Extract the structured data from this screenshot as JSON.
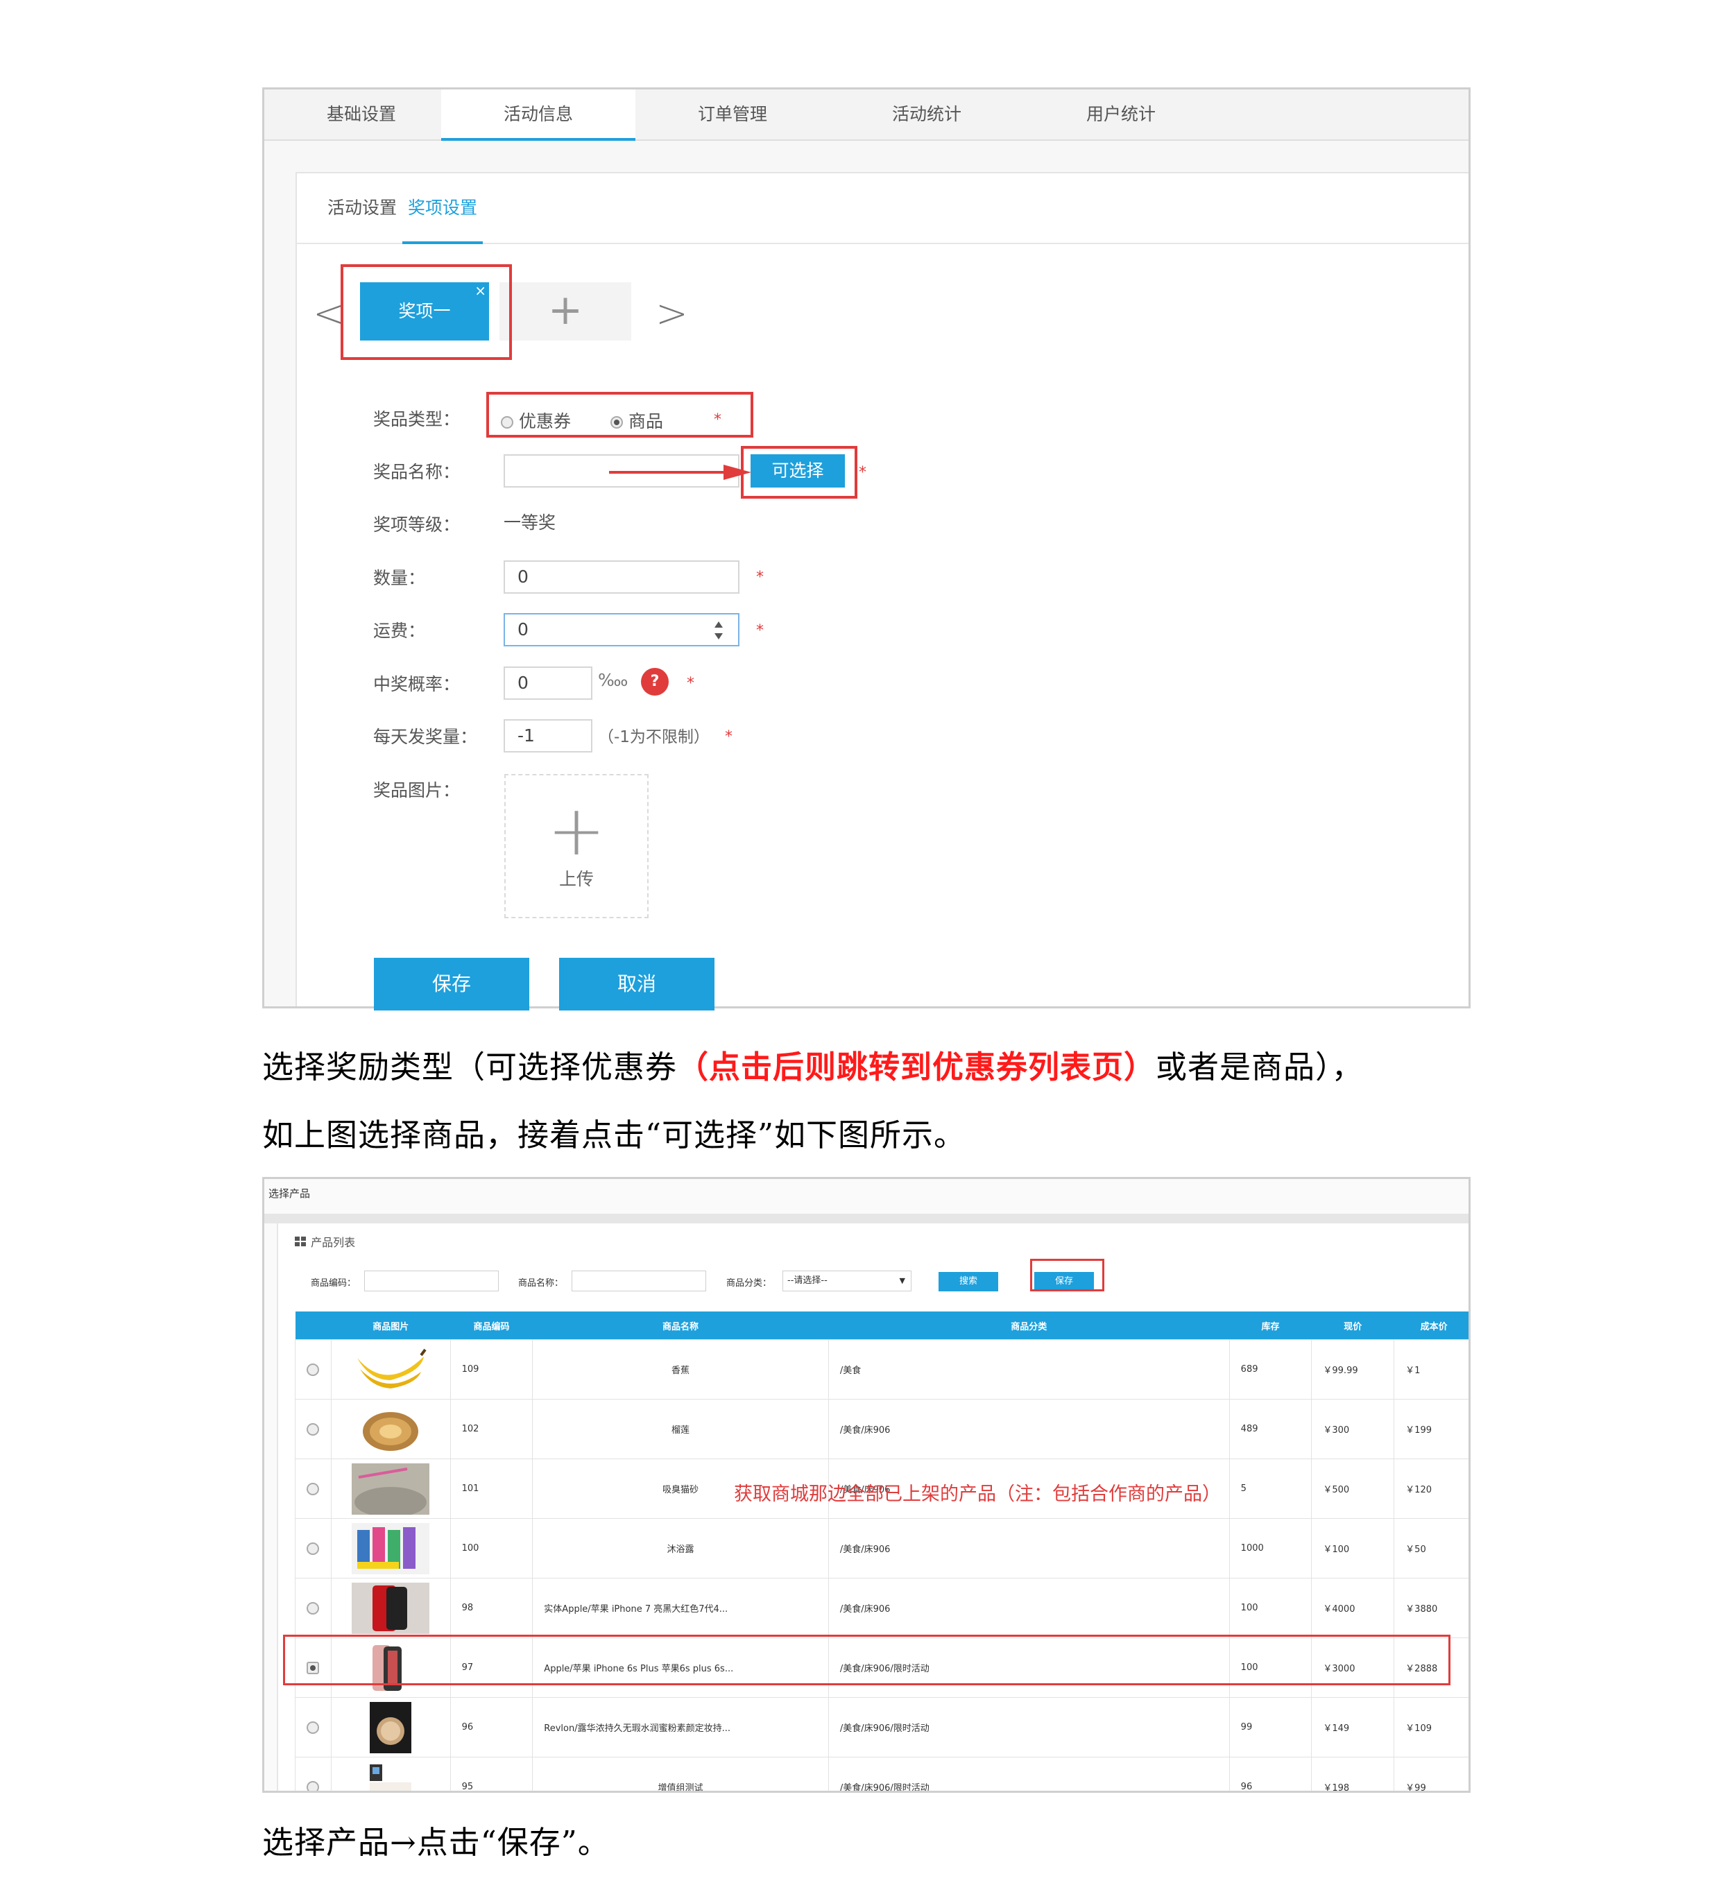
{
  "shot1": {
    "tabs": [
      "基础设置",
      "活动信息",
      "订单管理",
      "活动统计",
      "用户统计"
    ],
    "sub_tabs": [
      "活动设置",
      "奖项设置"
    ],
    "prize_tab": {
      "label": "奖项一",
      "close": "×",
      "add": "+"
    },
    "nav": {
      "prev": "<",
      "next": ">"
    },
    "form": {
      "type_label": "奖品类型：",
      "type_options": [
        "优惠券",
        "商品"
      ],
      "name_label": "奖品名称：",
      "choose_button": "可选择",
      "level_label": "奖项等级：",
      "level_value": "一等奖",
      "qty_label": "数量：",
      "qty_value": "0",
      "freight_label": "运费：",
      "freight_value": "0",
      "prob_label": "中奖概率：",
      "prob_value": "0",
      "prob_unit": "‱",
      "help": "?",
      "daily_label": "每天发奖量：",
      "daily_value": "-1",
      "daily_hint": "（-1为不限制）",
      "img_label": "奖品图片：",
      "upload_plus": "+",
      "upload_label": "上传",
      "required": "*"
    },
    "save": "保存",
    "cancel": "取消"
  },
  "caption1": {
    "part1": "选择奖励类型（可选择优惠券",
    "highlight": "（点击后则跳转到优惠券列表页）",
    "part2": "或者是商品），",
    "line2": "如上图选择商品，接着点击“可选择”如下图所示。"
  },
  "shot2": {
    "dialog_title": "选择产品",
    "list_title": "产品列表",
    "search": {
      "code_label": "商品编码：",
      "name_label": "商品名称：",
      "cat_label": "商品分类：",
      "cat_value": "--请选择--",
      "caret": "▼",
      "search_button": "搜索",
      "save_button": "保存"
    },
    "columns": [
      "",
      "商品图片",
      "商品编码",
      "商品名称",
      "商品分类",
      "库存",
      "现价",
      "成本价"
    ],
    "rows": [
      {
        "code": "109",
        "name": "香蕉",
        "category": "/美食",
        "stock": "689",
        "price": "￥99.99",
        "cost": "￥1",
        "selected": false,
        "img": "banana"
      },
      {
        "code": "102",
        "name": "榴莲",
        "category": "/美食/床906",
        "stock": "489",
        "price": "￥300",
        "cost": "￥199",
        "selected": false,
        "img": "durian"
      },
      {
        "code": "101",
        "name": "吸臭猫砂",
        "category": "/美食/床906",
        "stock": "5",
        "price": "￥500",
        "cost": "￥120",
        "selected": false,
        "img": "litter"
      },
      {
        "code": "100",
        "name": "沐浴露",
        "category": "/美食/床906",
        "stock": "1000",
        "price": "￥100",
        "cost": "￥50",
        "selected": false,
        "img": "bottles"
      },
      {
        "code": "98",
        "name": "实体Apple/苹果 iPhone 7 亮黑大红色7代4...",
        "category": "/美食/床906",
        "stock": "100",
        "price": "￥4000",
        "cost": "￥3880",
        "selected": false,
        "img": "iphone7"
      },
      {
        "code": "97",
        "name": "Apple/苹果 iPhone 6s Plus 苹果6s plus 6s...",
        "category": "/美食/床906/限时活动",
        "stock": "100",
        "price": "￥3000",
        "cost": "￥2888",
        "selected": true,
        "img": "iphone6s"
      },
      {
        "code": "96",
        "name": "Revlon/露华浓持久无瑕水润蜜粉素颜定妆持...",
        "category": "/美食/床906/限时活动",
        "stock": "99",
        "price": "￥149",
        "cost": "￥109",
        "selected": false,
        "img": "powder"
      },
      {
        "code": "95",
        "name": "增值组测试",
        "category": "/美食/床906/限时活动",
        "stock": "96",
        "price": "￥198",
        "cost": "￥99",
        "selected": false,
        "img": "misc"
      }
    ],
    "note": "获取商城那边全部已上架的产品（注：包括合作商的产品）"
  },
  "caption2": "选择产品→点击“保存”。",
  "colors": {
    "accent": "#1ea0dc",
    "annotation_red": "#e03c3c",
    "caption_red": "#ff1a1a"
  }
}
